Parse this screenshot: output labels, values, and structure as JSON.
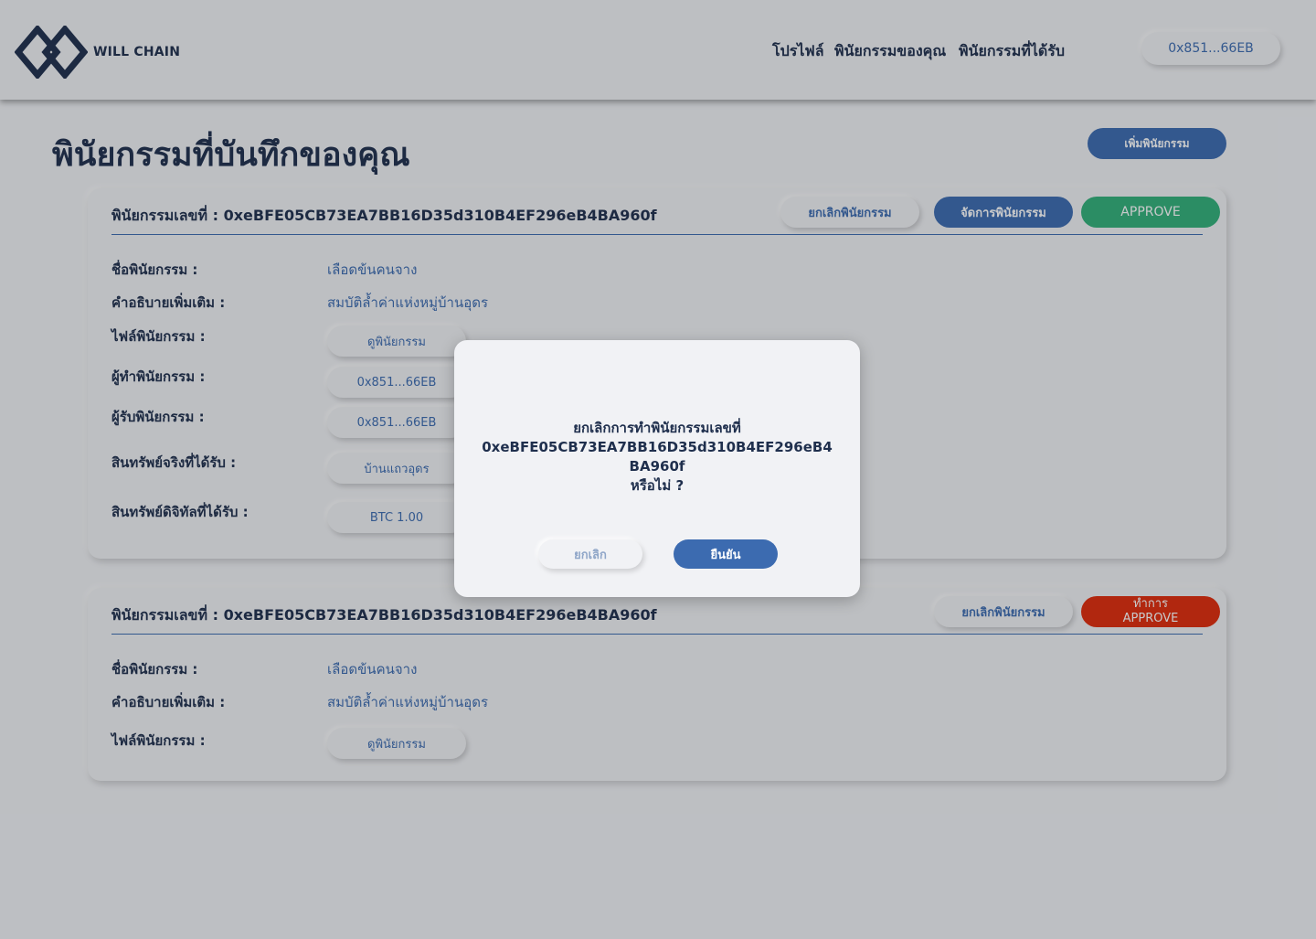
{
  "brand": {
    "name": "WILL CHAIN",
    "color": "#1f2f4d"
  },
  "nav": {
    "profile": "โปรไฟล์",
    "your_wills": "พินัยกรรมของคุณ",
    "received_wills": "พินัยกรรมที่ได้รับ",
    "wallet_address": "0x851...66EB"
  },
  "page": {
    "title": "พินัยกรรมที่บันทึกของคุณ",
    "add_button": "เพิ่มพินัยกรรม"
  },
  "colors": {
    "primary": "#3c6bb0",
    "dark": "#1f2f4d",
    "approve": "#31b07a",
    "danger": "#e12b0a",
    "background": "#f1f2f5"
  },
  "cards": [
    {
      "title": "พินัยกรรมเลขที่ : 0xeBFE05CB73EA7BB16D35d310B4EF296eB4BA960f",
      "actions": {
        "cancel": "ยกเลิกพินัยกรรม",
        "manage": "จัดการพินัยกรรม",
        "approve": "APPROVE"
      },
      "fields": {
        "name_label": "ชื่อพินัยกรรม :",
        "name_value": "เลือดข้นคนจาง",
        "desc_label": "คำอธิบายเพิ่มเติม :",
        "desc_value": "สมบัติล้ำค่าแห่งหมู่บ้านอุดร",
        "file_label": "ไฟล์พินัยกรรม :",
        "file_value": "ดูพินัยกรรม",
        "maker_label": "ผู้ทำพินัยกรรม :",
        "maker_value": "0x851...66EB",
        "receiver_label": "ผู้รับพินัยกรรม :",
        "receiver_value": "0x851...66EB",
        "real_asset_label": "สินทรัพย์จริงที่ได้รับ :",
        "real_asset_value": "บ้านแถวอุดร",
        "digital_asset_label": "สินทรัพย์ดิจิทัลที่ได้รับ :",
        "digital_asset_value": "BTC 1.00"
      }
    },
    {
      "title": "พินัยกรรมเลขที่ : 0xeBFE05CB73EA7BB16D35d310B4EF296eB4BA960f",
      "actions": {
        "cancel": "ยกเลิกพินัยกรรม",
        "approve_line1": "ทำการ",
        "approve_line2": "APPROVE"
      },
      "fields": {
        "name_label": "ชื่อพินัยกรรม :",
        "name_value": "เลือดข้นคนจาง",
        "desc_label": "คำอธิบายเพิ่มเติม :",
        "desc_value": "สมบัติล้ำค่าแห่งหมู่บ้านอุดร",
        "file_label": "ไฟล์พินัยกรรม :",
        "file_value": "ดูพินัยกรรม"
      }
    }
  ],
  "modal": {
    "line1": "ยกเลิกการทำพินัยกรรมเลขที่",
    "line2": "0xeBFE05CB73EA7BB16D35d310B4EF296eB4BA960f",
    "line3": "หรือไม่ ?",
    "cancel": "ยกเลิก",
    "confirm": "ยืนยัน"
  }
}
